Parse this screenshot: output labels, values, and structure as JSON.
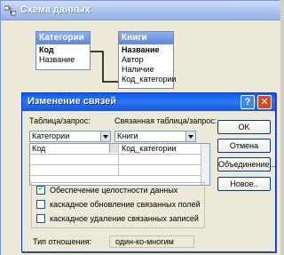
{
  "background_window": {
    "title": "Схема данных"
  },
  "tables": [
    {
      "name": "Категории",
      "fields": [
        {
          "name": "Код",
          "key": true
        },
        {
          "name": "Название",
          "key": false
        }
      ]
    },
    {
      "name": "Книги",
      "fields": [
        {
          "name": "Название",
          "key": true
        },
        {
          "name": "Автор",
          "key": false
        },
        {
          "name": "Наличие",
          "key": false
        },
        {
          "name": "Код_категории",
          "key": false
        }
      ]
    }
  ],
  "dialog": {
    "title": "Изменение связей",
    "help_glyph": "?",
    "close_glyph": "✕",
    "table_label": "Таблица/запрос:",
    "related_label": "Связанная таблица/запрос:",
    "table_value": "Категории",
    "related_value": "Книги",
    "fields_grid": [
      {
        "left": "Код",
        "right": "Код_категории"
      },
      {
        "left": "",
        "right": ""
      },
      {
        "left": "",
        "right": ""
      }
    ],
    "buttons": {
      "ok": "OK",
      "cancel": "Отмена",
      "join": "Объединение...",
      "new": "Новое.."
    },
    "options": {
      "integrity": {
        "label": "Обеспечение целостности данных",
        "checked": true
      },
      "cascade_update": {
        "label": "каскадное обновление связанных полей",
        "checked": false
      },
      "cascade_delete": {
        "label": "каскадное удаление связанных записей",
        "checked": false
      }
    },
    "relation_type_label": "Тип отношения:",
    "relation_type_value": "один-ко-многим"
  },
  "colors": {
    "dialog_titlebar": "#1959de",
    "table_titlebar": "#5f87d6",
    "window_bg": "#ece9d8",
    "check_mark": "#21a121"
  }
}
